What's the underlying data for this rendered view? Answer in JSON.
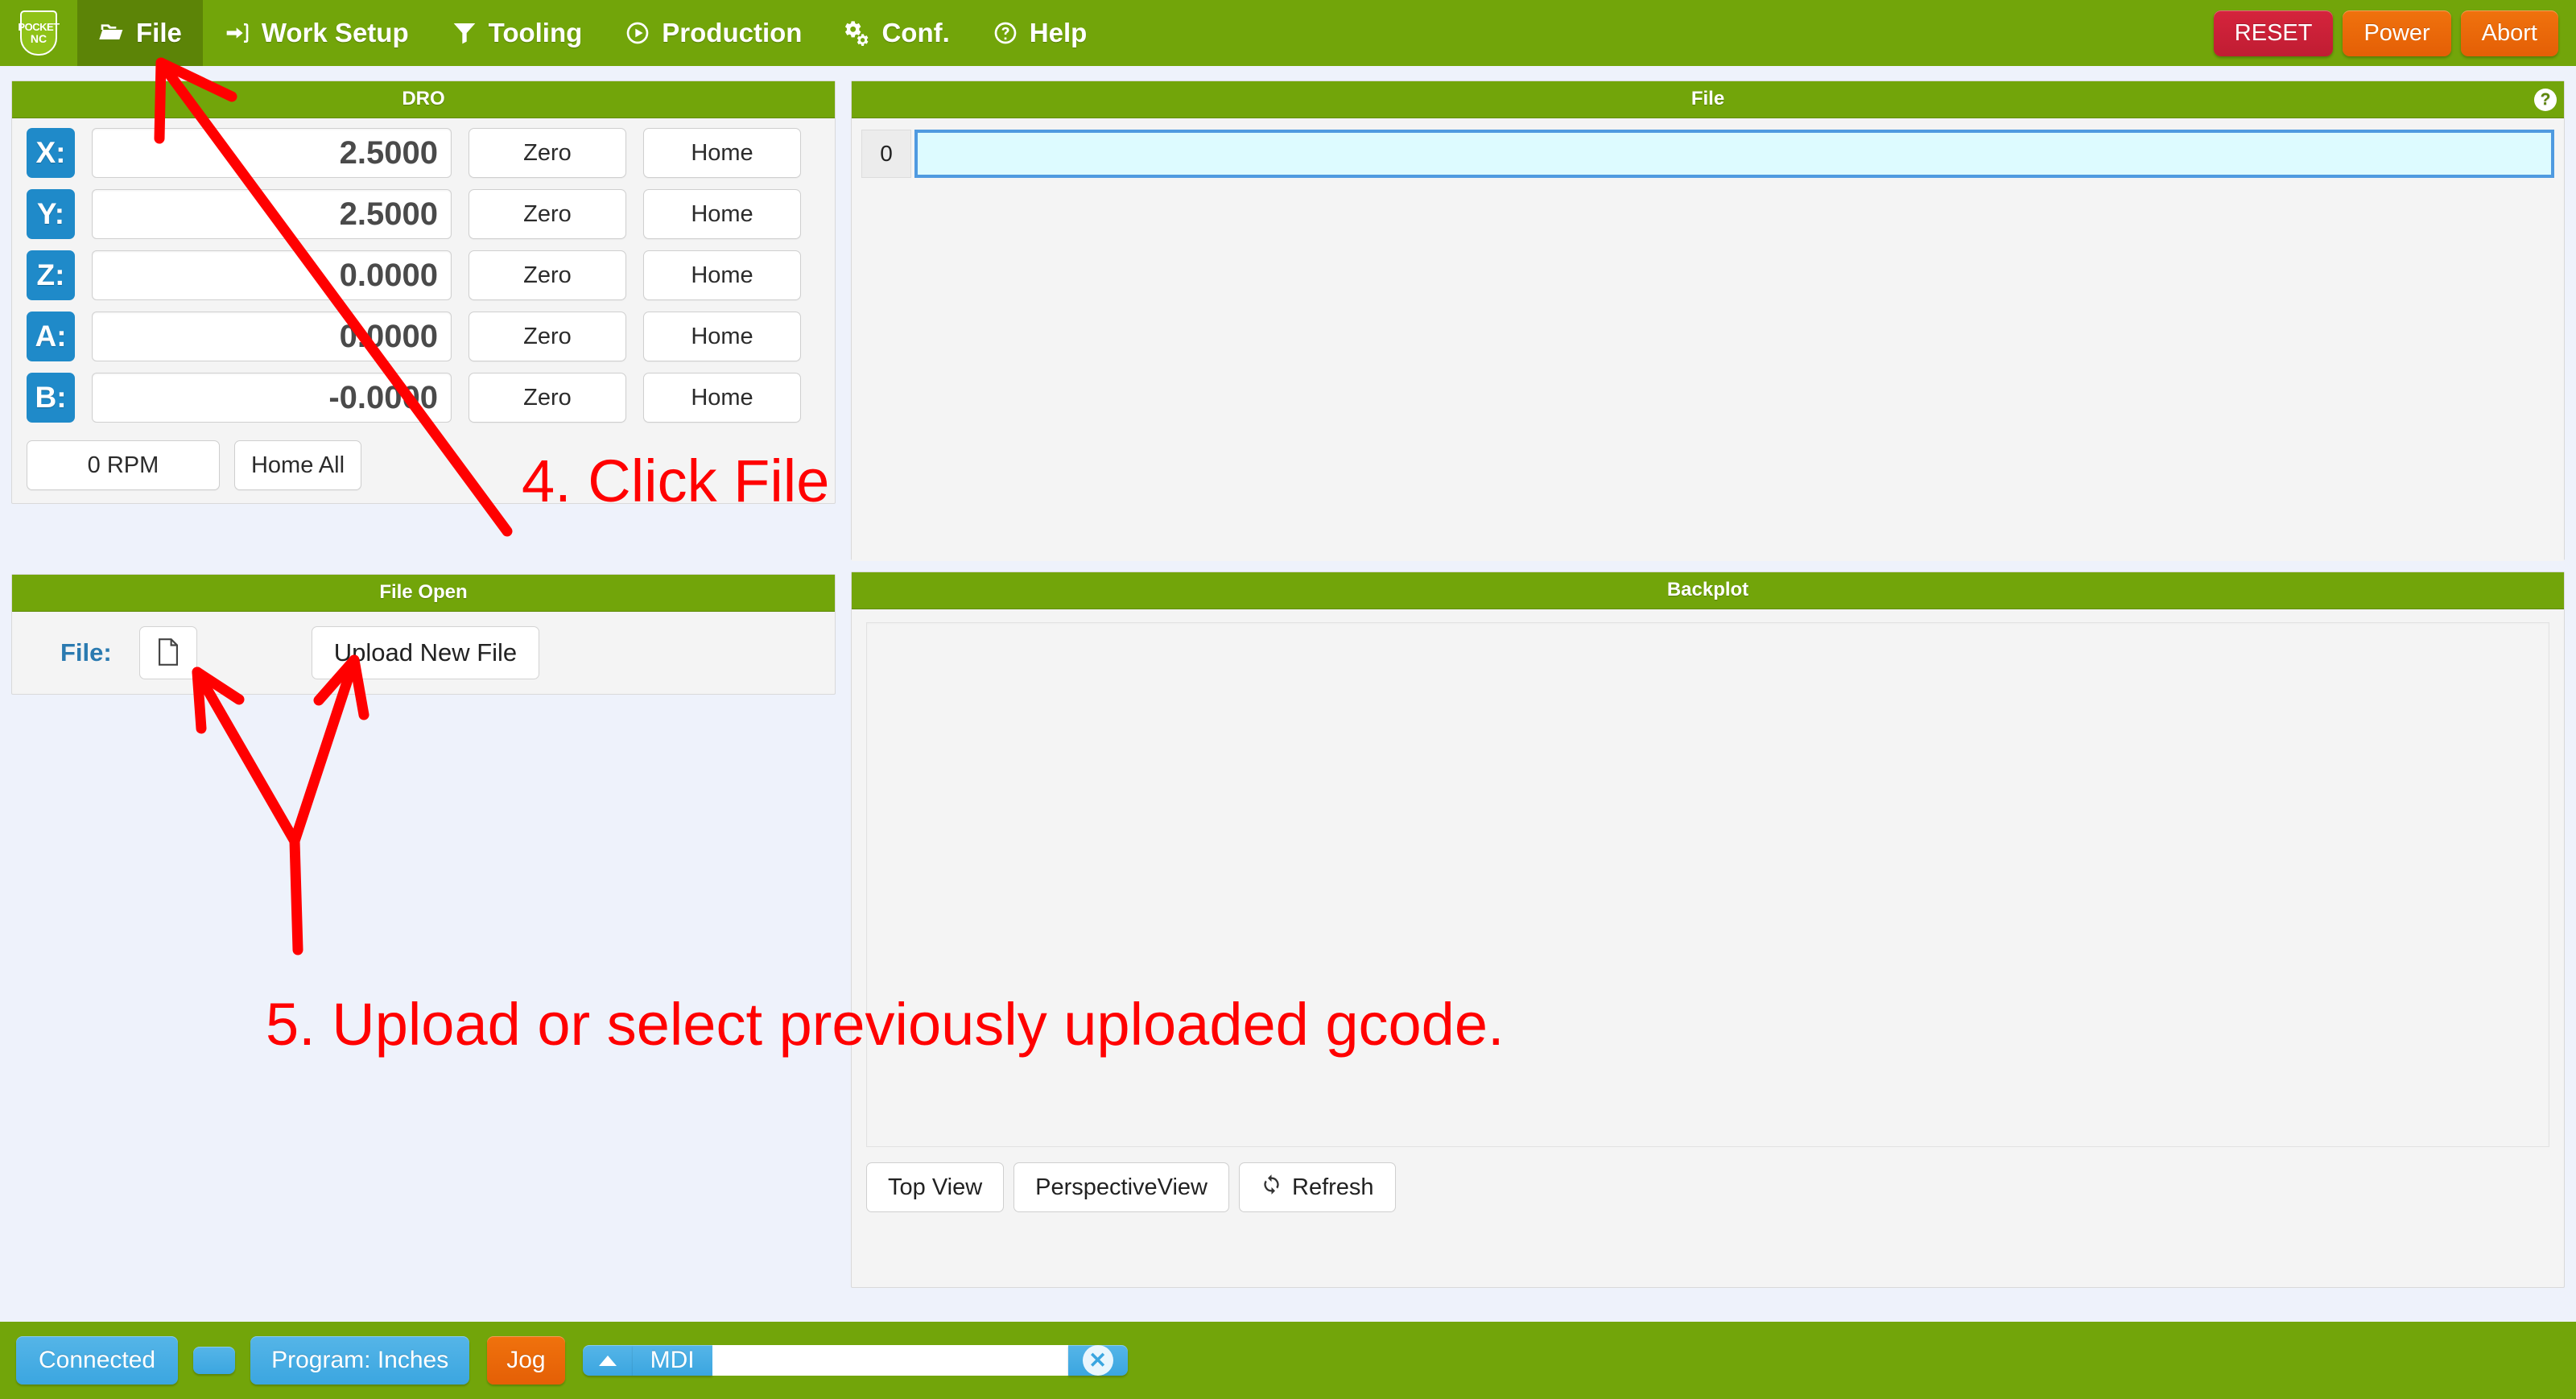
{
  "app": {
    "brand": {
      "line1": "POCKET",
      "line2": "NC"
    }
  },
  "navbar": {
    "items": [
      {
        "label": "File",
        "icon": "folder-open-icon",
        "active": true
      },
      {
        "label": "Work Setup",
        "icon": "sign-in-icon",
        "active": false
      },
      {
        "label": "Tooling",
        "icon": "filter-icon",
        "active": false
      },
      {
        "label": "Production",
        "icon": "play-circle-icon",
        "active": false
      },
      {
        "label": "Conf.",
        "icon": "gears-icon",
        "active": false
      },
      {
        "label": "Help",
        "icon": "question-circle-icon",
        "active": false
      }
    ],
    "buttons": {
      "reset": "RESET",
      "power": "Power",
      "abort": "Abort"
    },
    "colors": {
      "bar_green": "#72a50a",
      "active_green": "#5c8407",
      "reset_red": "#c01d33",
      "orange": "#e45f06"
    }
  },
  "dro": {
    "title": "DRO",
    "axes": [
      {
        "label": "X:",
        "value": "2.5000",
        "zero": "Zero",
        "home": "Home"
      },
      {
        "label": "Y:",
        "value": "2.5000",
        "zero": "Zero",
        "home": "Home"
      },
      {
        "label": "Z:",
        "value": "0.0000",
        "zero": "Zero",
        "home": "Home"
      },
      {
        "label": "A:",
        "value": "0.0000",
        "zero": "Zero",
        "home": "Home"
      },
      {
        "label": "B:",
        "value": "-0.0000",
        "zero": "Zero",
        "home": "Home"
      }
    ],
    "spindle_rpm": "0 RPM",
    "home_all": "Home All",
    "axis_tag_color": "#1f8ac9"
  },
  "file_open": {
    "title": "File Open",
    "label": "File:",
    "browse_icon": "file-icon",
    "upload_button": "Upload New File",
    "label_color": "#2a7ab0"
  },
  "file_viewer": {
    "title": "File",
    "help_icon": "question-circle-icon",
    "help_glyph": "?",
    "lines": [
      {
        "number": "0",
        "text": ""
      }
    ],
    "highlight_border": "#4f9ae0",
    "highlight_fill": "#ddfbff"
  },
  "backplot": {
    "title": "Backplot",
    "buttons": [
      {
        "label": "Top View",
        "icon": null
      },
      {
        "label": "PerspectiveView",
        "icon": null
      },
      {
        "label": "Refresh",
        "icon": "refresh-icon"
      }
    ]
  },
  "statusbar": {
    "connection": "Connected",
    "toggle_pill": "",
    "program_units": "Program: Inches",
    "mode": "Jog",
    "mdi_up_icon": "caret-up-icon",
    "mdi_label": "MDI",
    "mdi_value": "",
    "mdi_placeholder": "",
    "mdi_clear_icon": "times-circle-icon",
    "mdi_clear_glyph": "✕"
  },
  "annotations": {
    "color": "#ff0000",
    "step4": "4. Click File",
    "step5": "5. Upload or select previously uploaded gcode."
  }
}
